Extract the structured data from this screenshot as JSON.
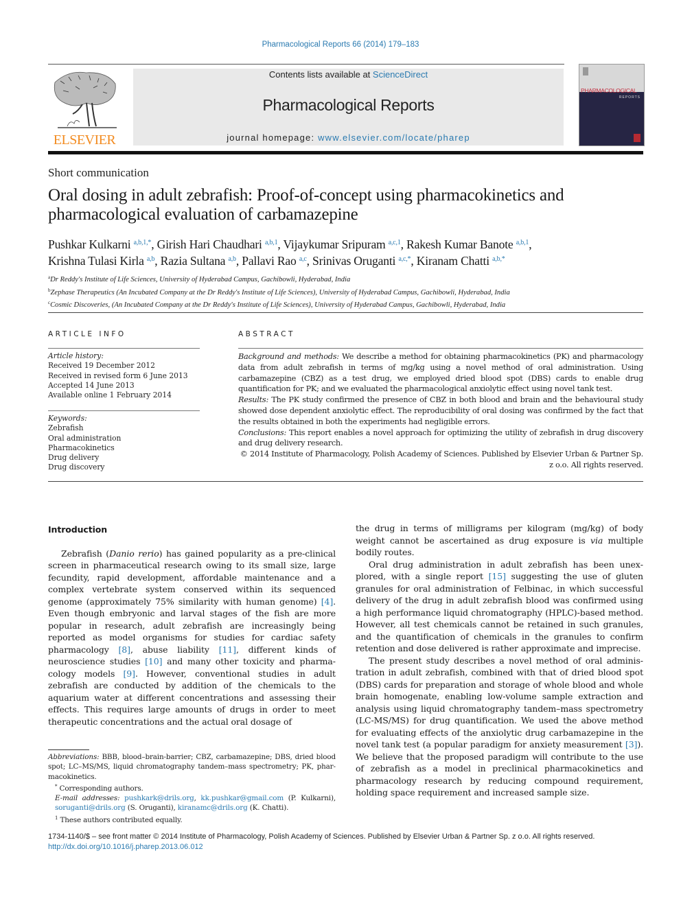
{
  "journal_ref": "Pharmacological Reports 66 (2014) 179–183",
  "masthead": {
    "contents_prefix": "Contents lists available at ",
    "contents_link": "ScienceDirect",
    "journal_title": "Pharmacological Reports",
    "homepage_prefix": "journal homepage: ",
    "homepage_link": "www.elsevier.com/locate/pharep",
    "publisher": "ELSEVIER",
    "cover_title": "PHARMACOLOGICAL",
    "cover_subtitle": "REPORTS",
    "publisher_color": "#f28b20",
    "link_color": "#2a7ab0"
  },
  "article_type": "Short communication",
  "title": "Oral dosing in adult zebrafish: Proof-of-concept using pharmacokinetics and pharmacological evaluation of carbamazepine",
  "authors": [
    {
      "name": "Pushkar Kulkarni",
      "sup": "a,b,1,*",
      "sep": ", "
    },
    {
      "name": "Girish Hari Chaudhari",
      "sup": "a,b,1",
      "sep": ", "
    },
    {
      "name": "Vijaykumar Sripuram",
      "sup": "a,c,1",
      "sep": ", "
    },
    {
      "name": "Rakesh Kumar Banote",
      "sup": "a,b,1",
      "sep": ", "
    },
    {
      "name": "Krishna Tulasi Kirla",
      "sup": "a,b",
      "sep": ", "
    },
    {
      "name": "Razia Sultana",
      "sup": "a,b",
      "sep": ", "
    },
    {
      "name": "Pallavi Rao",
      "sup": "a,c",
      "sep": ", "
    },
    {
      "name": "Srinivas Oruganti",
      "sup": "a,c,*",
      "sep": ", "
    },
    {
      "name": "Kiranam Chatti",
      "sup": "a,b,*",
      "sep": ""
    }
  ],
  "affiliations": [
    {
      "key": "a",
      "text": "Dr Reddy's Institute of Life Sciences, University of Hyderabad Campus, Gachibowli, Hyderabad, India"
    },
    {
      "key": "b",
      "text": "Zephase Therapeutics (An Incubated Company at the Dr Reddy's Institute of Life Sciences), University of Hyderabad Campus, Gachibowli, Hyderabad, India"
    },
    {
      "key": "c",
      "text": "Cosmic Discoveries, (An Incubated Company at the Dr Reddy's Institute of Life Sciences), University of Hyderabad Campus, Gachibowli, Hyderabad, India"
    }
  ],
  "article_info": {
    "heading": "ARTICLE INFO",
    "history_label": "Article history:",
    "history": [
      "Received 19 December 2012",
      "Received in revised form 6 June 2013",
      "Accepted 14 June 2013",
      "Available online 1 February 2014"
    ],
    "keywords_label": "Keywords:",
    "keywords": [
      "Zebrafish",
      "Oral administration",
      "Pharmacokinetics",
      "Drug delivery",
      "Drug discovery"
    ]
  },
  "abstract": {
    "heading": "ABSTRACT",
    "background_label": "Background and methods:",
    "background": " We describe a method for obtaining pharmacokinetics (PK) and pharmacology data from adult zebrafish in terms of mg/kg using a novel method of oral administration. Using carbamazepine (CBZ) as a test drug, we employed dried blood spot (DBS) cards to enable drug quantification for PK; and we evaluated the pharmacological anxiolytic effect using novel tank test.",
    "results_label": "Results:",
    "results": " The PK study confirmed the presence of CBZ in both blood and brain and the behavioural study showed dose dependent anxiolytic effect. The reproducibility of oral dosing was confirmed by the fact that the results obtained in both the experiments had negligible errors.",
    "conclusions_label": "Conclusions:",
    "conclusions": " This report enables a novel approach for optimizing the utility of zebrafish in drug discovery and drug delivery research.",
    "copyright_line1": "© 2014 Institute of Pharmacology, Polish Academy of Sciences. Published by Elsevier Urban & Partner Sp.",
    "copyright_line2": "z o.o. All rights reserved."
  },
  "introduction": {
    "heading": "Introduction",
    "p1": {
      "t1": "Zebrafish (",
      "species": "Danio rerio",
      "t2": ") has gained popularity as a pre-clinical screen in pharmaceutical research owing to its small size, large fecundity, rapid development, affordable maintenance and a complex vertebrate system conserved within its sequenced genome (approximately 75% similarity with human genome) ",
      "r4": "[4]",
      "t3": ". Even though embryonic and larval stages of the fish are more popular in research, adult zebrafish are increasingly being reported as model organisms for studies for cardiac safety pharmacology ",
      "r8": "[8]",
      "t4": ", abuse liability ",
      "r11": "[11]",
      "t5": ", different kinds of neuroscience studies ",
      "r10": "[10]",
      "t6": " and many other toxicity and pharma­cology models ",
      "r9": "[9]",
      "t7": ". However, conventional studies in adult zebrafish are conducted by addition of the chemicals to the aquarium water at different concentrations and assessing their effects. This requires large amounts of drugs in order to meet therapeutic concentrations and the actual oral dosage of"
    },
    "p1_cont": {
      "t1": "the drug in terms of milligrams per kilogram (mg/kg) of body weight cannot be ascertained as drug exposure is ",
      "via": "via",
      "t2": " multiple bodily routes."
    },
    "p2": {
      "t1": "Oral drug administration in adult zebrafish has been unex­plored, with a single report ",
      "r15": "[15]",
      "t2": " suggesting the use of gluten granules for oral administration of Felbinac, in which successful delivery of the drug in adult zebrafish blood was confirmed using a high performance liquid chromatography (HPLC)-based method. However, all test chemicals cannot be retained in such granules, and the quantification of chemicals in the granules to confirm retention and dose delivered is rather approximate and imprecise."
    },
    "p3": {
      "t1": "The present study describes a novel method of oral adminis­tration in adult zebrafish, combined with that of dried blood spot (DBS) cards for preparation and storage of whole blood and whole brain homogenate, enabling low-volume sample extraction and analysis using liquid chromatography tandem–mass spectrometry (LC-MS/MS) for drug quantification. We used the above method for evaluating effects of the anxiolytic drug carbamazepine in the novel tank test (a popular paradigm for anxiety measurement ",
      "r3": "[3]",
      "t2": "). We believe that the proposed paradigm will contribute to the use of zebrafish as a model in preclinical pharmacokinetics and pharmacology research by reducing compound requirement, holding space requirement and increased sample size."
    }
  },
  "footnotes": {
    "abbr_label": "Abbreviations:",
    "abbr_text": " BBB, blood–brain-barrier; CBZ, carbamazepine; DBS, dried blood spot; LC–MS/MS, liquid chromatography tandem–mass spectrometry; PK, phar­macokinetics.",
    "corr_mark": "*",
    "corr_text": " Corresponding authors.",
    "email_label": "E-mail addresses:",
    "emails": [
      {
        "addr": "pushkark@drils.org",
        "after": ", "
      },
      {
        "addr": "kk.pushkar@gmail.com",
        "after": " (P. Kulkarni), "
      },
      {
        "addr": "soruganti@drils.org",
        "after": " (S. Oruganti), "
      },
      {
        "addr": "kiranamc@drils.org",
        "after": " (K. Chatti)."
      }
    ],
    "equal_mark": "1",
    "equal_text": " These authors contributed equally."
  },
  "bottom": {
    "issn_line": "1734-1140/$ – see front matter © 2014 Institute of Pharmacology, Polish Academy of Sciences. Published by Elsevier Urban & Partner Sp. z o.o. All rights reserved.",
    "doi": "http://dx.doi.org/10.1016/j.pharep.2013.06.012"
  }
}
